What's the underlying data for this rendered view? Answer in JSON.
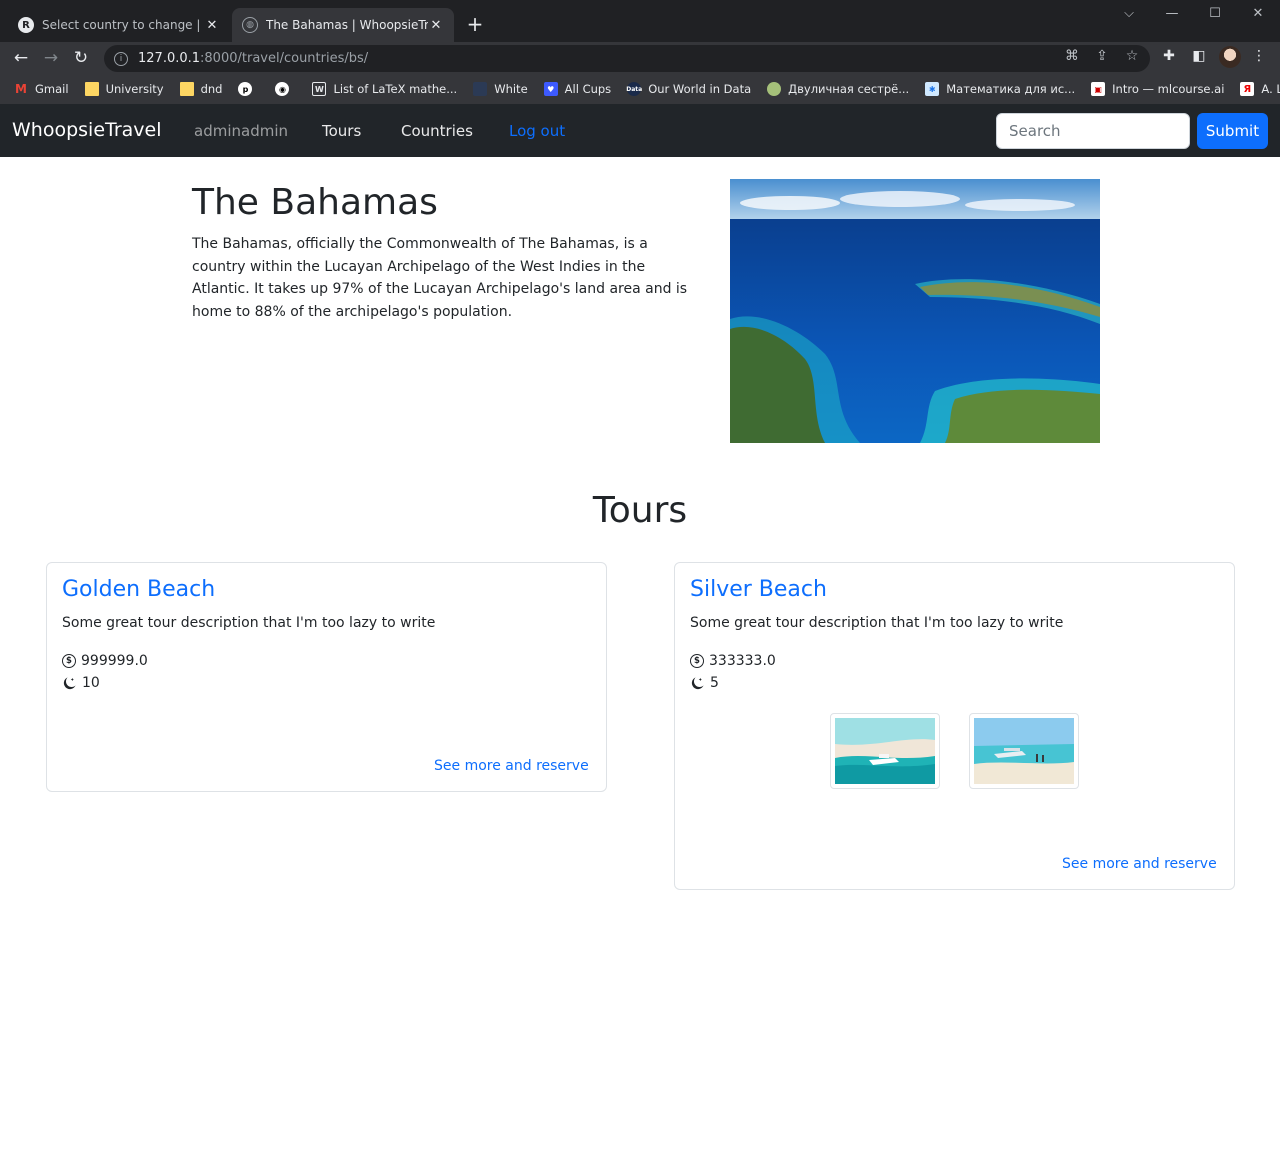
{
  "browser": {
    "tabs": [
      {
        "title": "Select country to change | Django site admin",
        "active": false
      },
      {
        "title": "The Bahamas | WhoopsieTravel",
        "active": true
      }
    ],
    "url_host": "127.0.0.1",
    "url_path": ":8000/travel/countries/bs/",
    "bookmarks": [
      {
        "label": "Gmail",
        "icon": "gmail-icon"
      },
      {
        "label": "University",
        "icon": "folder-icon"
      },
      {
        "label": "dnd",
        "icon": "folder-icon"
      },
      {
        "label": "",
        "icon": "p-icon"
      },
      {
        "label": "",
        "icon": "github-icon"
      },
      {
        "label": "List of LaTeX mathe...",
        "icon": "latex-icon"
      },
      {
        "label": "White",
        "icon": "square-icon"
      },
      {
        "label": "All Cups",
        "icon": "shield-icon"
      },
      {
        "label": "Our World in Data",
        "icon": "data-icon"
      },
      {
        "label": "Двуличная сестрё...",
        "icon": "circle-icon"
      },
      {
        "label": "Математика для ис...",
        "icon": "snowflake-icon"
      },
      {
        "label": "Intro — mlcourse.ai",
        "icon": "mlcourse-icon"
      },
      {
        "label": "A. Like prediction...",
        "icon": "yandex-icon"
      }
    ]
  },
  "navbar": {
    "brand": "WhoopsieTravel",
    "username": "adminadmin",
    "tours": "Tours",
    "countries": "Countries",
    "logout": "Log out",
    "search_placeholder": "Search",
    "submit": "Submit"
  },
  "country": {
    "name": "The Bahamas",
    "description": "The Bahamas, officially the Commonwealth of The Bahamas, is a country within the Lucayan Archipelago of the West Indies in the Atlantic. It takes up 97% of the Lucayan Archipelago's land area and is home to 88% of the archipelago's population."
  },
  "tours_heading": "Tours",
  "tours": [
    {
      "title": "Golden Beach",
      "description": "Some great tour description that I'm too lazy to write",
      "price": "999999.0",
      "nights": "10",
      "link": "See more and reserve"
    },
    {
      "title": "Silver Beach",
      "description": "Some great tour description that I'm too lazy to write",
      "price": "333333.0",
      "nights": "5",
      "link": "See more and reserve"
    }
  ],
  "colors": {
    "primary": "#0d6efd",
    "navbar_bg": "#212529",
    "chrome_bg": "#202124"
  }
}
